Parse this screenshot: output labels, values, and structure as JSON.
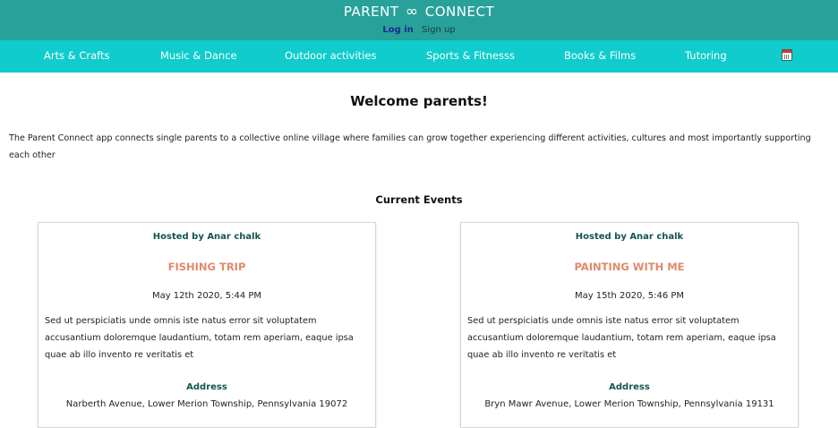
{
  "brand": {
    "left": "PARENT",
    "symbol": "∞",
    "right": "CONNECT"
  },
  "auth": {
    "login": "Log in",
    "signup": "Sign up"
  },
  "nav": {
    "items": [
      {
        "label": "Arts & Crafts"
      },
      {
        "label": "Music & Dance"
      },
      {
        "label": "Outdoor activities"
      },
      {
        "label": "Sports & Fitnesss"
      },
      {
        "label": "Books & Films"
      },
      {
        "label": "Tutoring"
      }
    ],
    "calendar_icon": "calendar-icon"
  },
  "main": {
    "welcome": "Welcome parents!",
    "intro": "The Parent Connect app connects single parents to a collective online village where families can grow together experiencing different activities, cultures and most importantly supporting each other",
    "events_heading": "Current Events"
  },
  "events": [
    {
      "host": "Hosted by Anar chalk",
      "title": "FISHING TRIP",
      "date": "May 12th 2020, 5:44 PM",
      "description": "Sed ut perspiciatis unde omnis iste natus error sit voluptatem accusantium doloremque laudantium, totam rem aperiam, eaque ipsa quae ab illo invento re veritatis et",
      "address_label": "Address",
      "address": "Narberth Avenue, Lower Merion Township, Pennsylvania 19072"
    },
    {
      "host": "Hosted by Anar chalk",
      "title": "PAINTING WITH ME",
      "date": "May 15th 2020, 5:46 PM",
      "description": "Sed ut perspiciatis unde omnis iste natus error sit voluptatem accusantium doloremque laudantium, totam rem aperiam, eaque ipsa quae ab illo invento re veritatis et",
      "address_label": "Address",
      "address": "Bryn Mawr Avenue, Lower Merion Township, Pennsylvania 19131"
    }
  ],
  "colors": {
    "header": "#27a19a",
    "nav": "#10cccc",
    "event_title": "#e08a6b",
    "host_text": "#13544f",
    "login_link": "#1a2a8c"
  }
}
